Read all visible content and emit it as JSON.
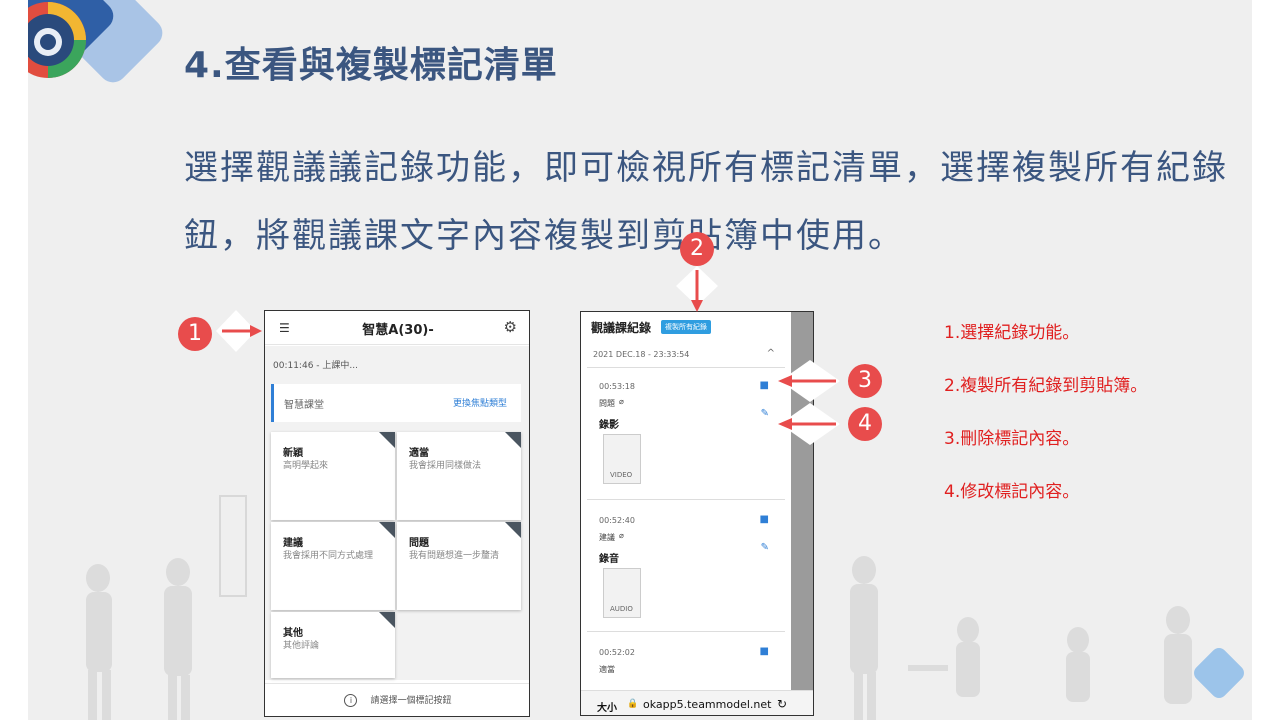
{
  "slide": {
    "title": "4.查看與複製標記清單",
    "body_line1": "選擇觀議議記錄功能，即可檢視所有標記清單，選擇複製所有紀錄",
    "body_line2": "鈕，將觀議課文字內容複製到剪貼簿中使用。"
  },
  "notes": [
    "1.選擇紀錄功能。",
    "2.複製所有紀錄到剪貼簿。",
    "3.刪除標記內容。",
    "4.修改標記內容。"
  ],
  "badges": [
    "1",
    "2",
    "3",
    "4"
  ],
  "phone1": {
    "header_title": "智慧A(30)-",
    "status": "00:11:46 - 上課中...",
    "category_label": "智慧課堂",
    "switch_link": "更換焦點類型",
    "cards": [
      {
        "title": "新穎",
        "desc": "高明學起來"
      },
      {
        "title": "適當",
        "desc": "我會採用同樣做法"
      },
      {
        "title": "建議",
        "desc": "我會採用不同方式處理"
      },
      {
        "title": "問題",
        "desc": "我有問題想進一步釐清"
      },
      {
        "title": "其他",
        "desc": "其他評論"
      }
    ],
    "footer_hint": "請選擇一個標記按鈕"
  },
  "phone2": {
    "header_title": "觀議課紀錄",
    "copy_button": "複製所有紀錄",
    "session": "2021 DEC.18 - 23:33:54",
    "records": [
      {
        "time": "00:53:18",
        "tag": "問題",
        "type": "錄影",
        "file_label": "VIDEO"
      },
      {
        "time": "00:52:40",
        "tag": "建議",
        "type": "錄音",
        "file_label": "AUDIO"
      },
      {
        "time": "00:52:02",
        "tag": "適當",
        "type": "",
        "file_label": ""
      }
    ],
    "url_size": "大小",
    "url": "okapp5.teammodel.net"
  },
  "colors": {
    "title": "#3b5680",
    "accent": "#e84c4c",
    "link": "#2f7fd6",
    "note_red": "#e02020"
  }
}
